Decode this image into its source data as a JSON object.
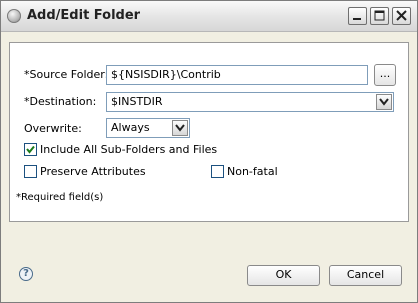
{
  "window": {
    "title": "Add/Edit Folder"
  },
  "form": {
    "source_folder_label": "*Source Folder:",
    "source_folder_value": "${NSISDIR}\\Contrib",
    "browse_label": "...",
    "destination_label": "*Destination:",
    "destination_value": "$INSTDIR",
    "overwrite_label": "Overwrite:",
    "overwrite_value": "Always",
    "include_subfolders_label": "Include All Sub-Folders and Files",
    "include_subfolders_checked": true,
    "preserve_attributes_label": "Preserve Attributes",
    "preserve_attributes_checked": false,
    "nonfatal_label": "Non-fatal",
    "nonfatal_checked": false
  },
  "required_note": "*Required field(s)",
  "buttons": {
    "ok": "OK",
    "cancel": "Cancel"
  },
  "help_glyph": "?",
  "icons": {
    "app": "eclipse-app-icon",
    "minimize": "minimize-icon",
    "maximize": "maximize-icon",
    "close": "close-icon",
    "dropdown": "chevron-down-icon",
    "check": "checkmark-icon",
    "help": "help-icon"
  },
  "colors": {
    "check_mark": "#1a7a1a",
    "field_border": "#7f9db9",
    "dialog_bg": "#f1efe2"
  }
}
